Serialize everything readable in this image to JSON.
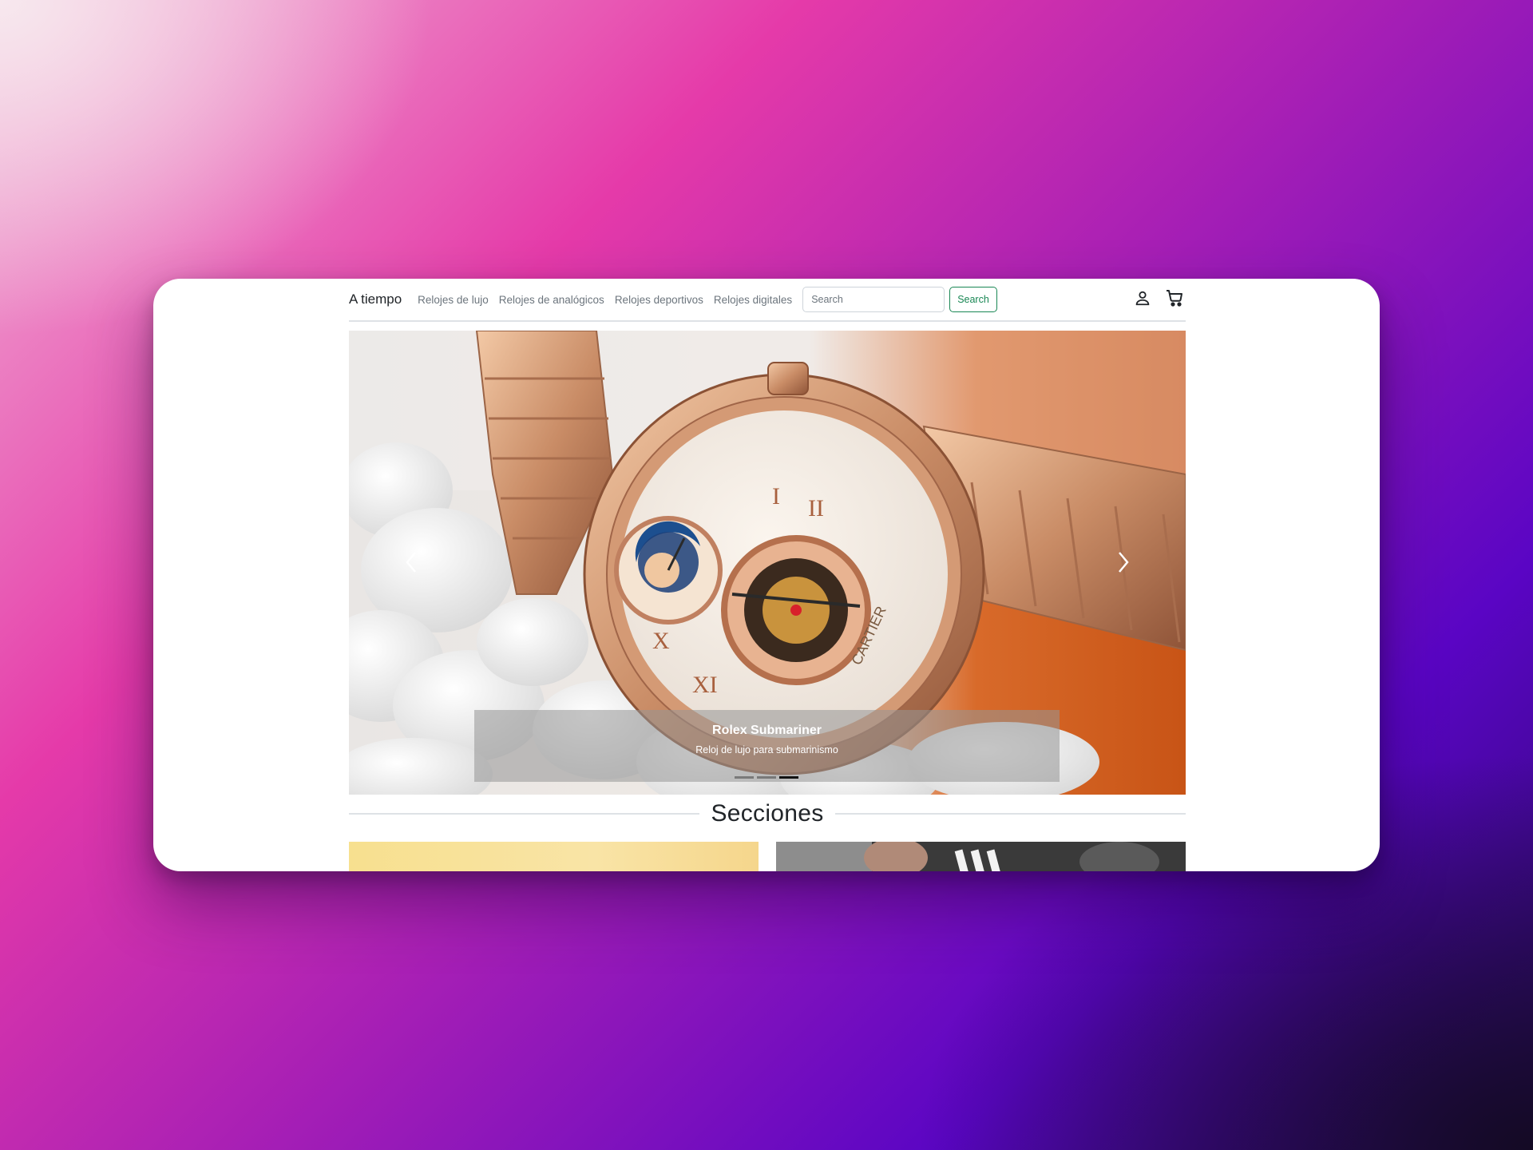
{
  "navbar": {
    "brand": "A tiempo",
    "links": [
      "Relojes de lujo",
      "Relojes de analógicos",
      "Relojes deportivos",
      "Relojes digitales"
    ],
    "search_placeholder": "Search",
    "search_button": "Search",
    "icons": [
      "user-icon",
      "cart-icon"
    ]
  },
  "carousel": {
    "slide_title": "Rolex Submariner",
    "slide_text": "Reloj de lujo para submarinismo",
    "slide_count": 3,
    "active_slide": 3,
    "image_subject": "rose-gold-watch-photo"
  },
  "sections": {
    "heading": "Secciones"
  },
  "colors": {
    "accent": "#198754",
    "window_bg": "#ffffff",
    "text": "#212529"
  }
}
